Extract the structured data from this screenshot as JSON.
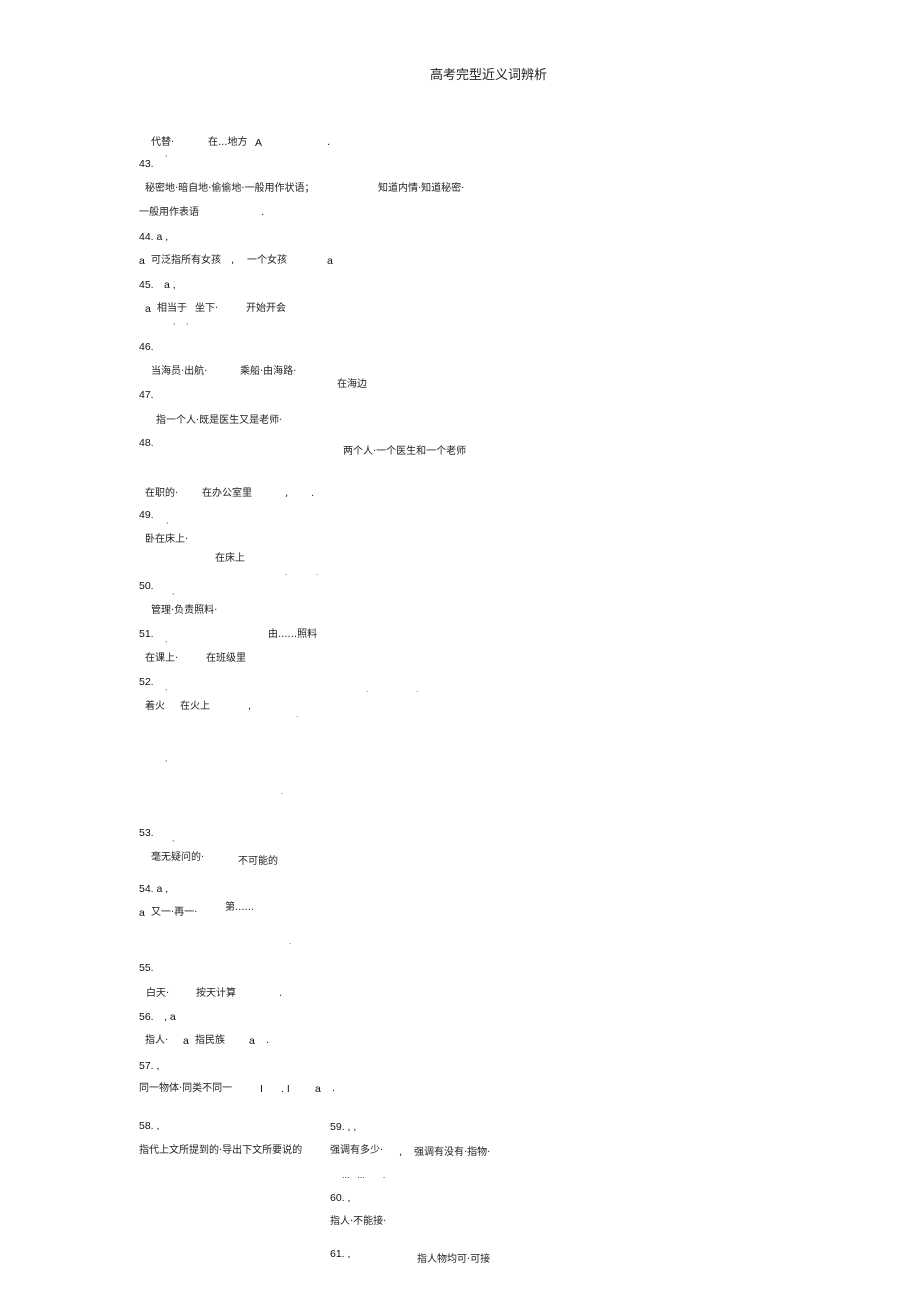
{
  "title": "高考完型近义词辨析",
  "fragments": {
    "l1a": "代替·",
    "l1b": "在...地方",
    "l1c": "A",
    "l1d": ".",
    "n43": "43.",
    "l43a": "秘密地·暗自地·偷偷地·一般用作状语；",
    "l43b": "知道内情·知道秘密·",
    "l43c": "一般用作表语",
    "l43d": ".",
    "n44": "44. a ,",
    "l44a": "a",
    "l44b": "可泛指所有女孩",
    "l44c": ",",
    "l44d": "一个女孩",
    "l44e": "a",
    "n45": "45.",
    "n45b": "a ,",
    "l45a": "a",
    "l45b": "相当于",
    "l45c": "坐下·",
    "l45d": "开始开会",
    "n46": "46.",
    "l46a": "当海员·出航·",
    "l46b": "乘船·由海路·",
    "l46c": "在海边",
    "n47": "47.",
    "l47a": "指一个人·既是医生又是老师·",
    "n48": "48.",
    "l48a": "两个人·一个医生和一个老师",
    "l48b": "在职的·",
    "l48c": "在办公室里",
    "l48d": ",",
    "l48e": ".",
    "n49": "49.",
    "l49a": "卧在床上·",
    "l49b": "在床上",
    "n50": "50.",
    "l50a": "管理·负责照料·",
    "n51": "51.",
    "l51a": "由......照料",
    "l51b": "在课上·",
    "l51c": "在班级里",
    "n52": "52.",
    "l52a": "着火",
    "l52b": "在火上",
    "l52c": ",",
    "n53": "53.",
    "l53a": "毫无疑问的·",
    "l53b": "不可能的",
    "n54": "54. a ,",
    "l54a": "a",
    "l54b": "又一·再一·",
    "l54c": "第......",
    "n55": "55.",
    "l55a": "白天·",
    "l55b": "按天计算",
    "l55c": ".",
    "n56": "56.",
    "n56b": ", a",
    "l56a": "指人·",
    "l56b": "a",
    "l56c": "指民族",
    "l56d": "a",
    "l56e": ".",
    "n57": "57. ,",
    "l57a": "同一物体·同类不同一",
    "l57b": "I",
    "l57c": ". I",
    "l57d": "a",
    "l57e": ".",
    "n58": "58. ,",
    "l58a": "指代上文所提到的·导出下文所要说的",
    "n59": "59. , ,",
    "l59a": "强调有多少·",
    "l59b": ",",
    "l59c": "强调有没有·指物·",
    "l59d": "...   ...       .",
    "n60": "60. ,",
    "l60a": "指人·不能接·",
    "n61": "61. ,",
    "l61a": "指人物均可·可接"
  }
}
